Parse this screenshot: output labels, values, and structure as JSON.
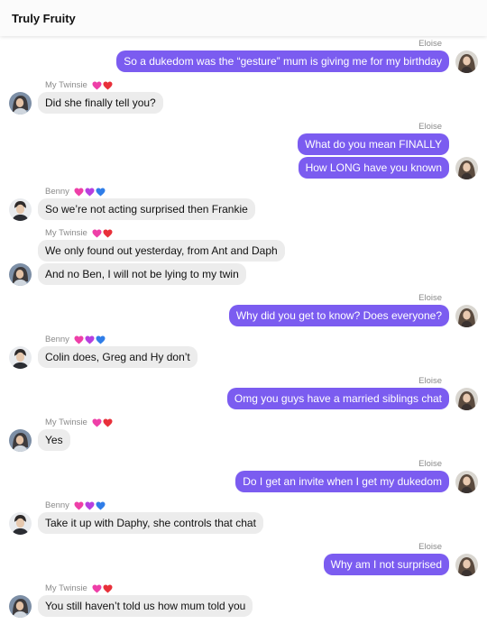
{
  "header": {
    "title": "Truly Fruity"
  },
  "names": {
    "eloise": "Eloise",
    "twinsie": "My Twinsie",
    "benny": "Benny"
  },
  "messages": [
    {
      "text": "So a dukedom was the “gesture” mum is giving me for my birthday"
    },
    {
      "text": "Did she finally tell you?"
    },
    {
      "text": "What do you mean FINALLY"
    },
    {
      "text": "How LONG have you known"
    },
    {
      "text": "So we’re not acting surprised then Frankie"
    },
    {
      "text": "We only found out yesterday, from Ant and Daph"
    },
    {
      "text": "And no Ben, I will not be lying to my twin"
    },
    {
      "text": "Why did you get to know? Does everyone?"
    },
    {
      "text": "Colin does, Greg and Hy don’t"
    },
    {
      "text": "Omg you guys have a married siblings chat"
    },
    {
      "text": "Yes"
    },
    {
      "text": "Do I get an invite when I get my dukedom"
    },
    {
      "text": "Take it up with Daphy, she controls that chat"
    },
    {
      "text": "Why am I not surprised"
    },
    {
      "text": "You still haven’t told us how mum told you"
    }
  ],
  "colors": {
    "sent_bubble": "#7b5cf0",
    "received_bubble": "#ececec",
    "heart_pink": "#ee3fa8",
    "heart_red": "#e8303a",
    "heart_purple": "#b53fe0",
    "heart_blue": "#2f7de8"
  },
  "icons": {
    "heart_pink": "pink-heart-icon",
    "heart_red": "red-heart-icon",
    "heart_purple": "purple-heart-icon",
    "heart_blue": "blue-heart-icon"
  }
}
